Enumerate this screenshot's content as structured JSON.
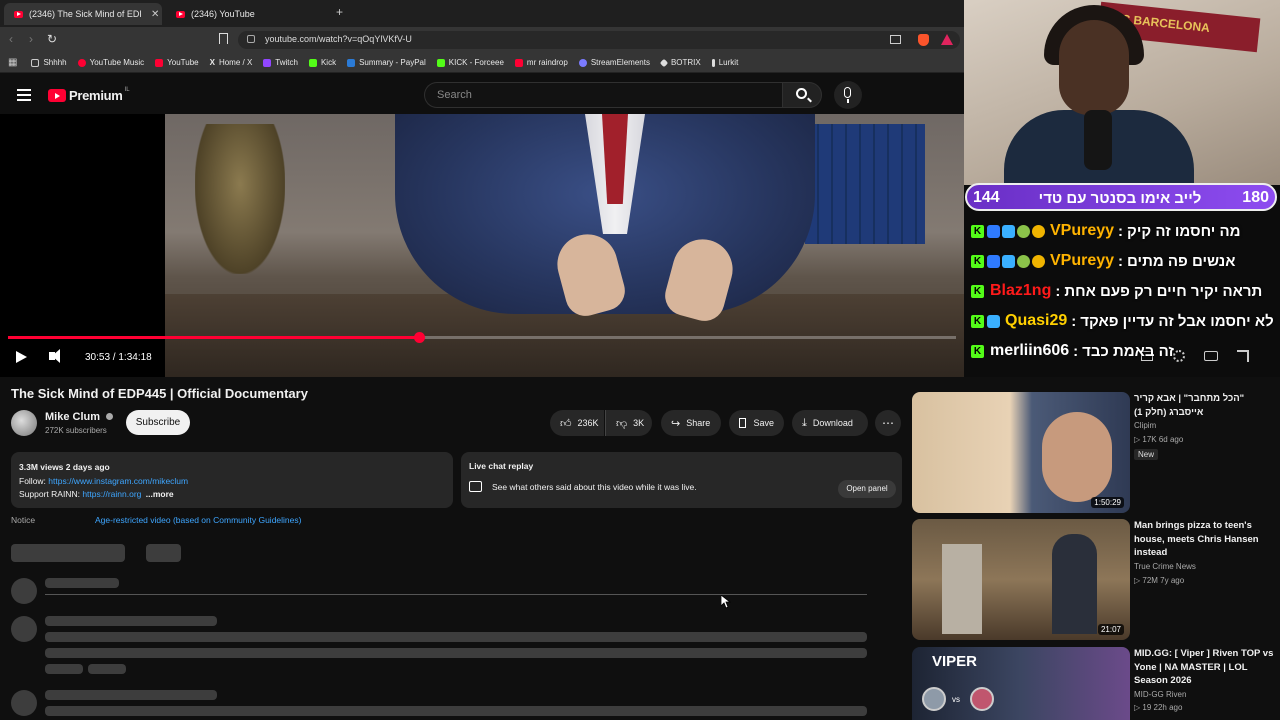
{
  "browser": {
    "tabs": [
      {
        "label": "(2346) The Sick Mind of EDP445",
        "active": true
      },
      {
        "label": "(2346) YouTube",
        "active": false
      }
    ],
    "new_tab": "+",
    "url": "youtube.com/watch?v=qOqYlVKfV-U",
    "bookmarks": [
      {
        "label": "Shhhh",
        "color": "#888888"
      },
      {
        "label": "YouTube Music",
        "color": "#ff0033"
      },
      {
        "label": "YouTube",
        "color": "#ff0033"
      },
      {
        "label": "Home / X",
        "color": "#ffffff"
      },
      {
        "label": "Twitch",
        "color": "#9146ff"
      },
      {
        "label": "Kick",
        "color": "#53fc18"
      },
      {
        "label": "Summary - PayPal",
        "color": "#2b7bd6"
      },
      {
        "label": "KICK - Forceee",
        "color": "#53fc18"
      },
      {
        "label": "mr raindrop",
        "color": "#ff0033"
      },
      {
        "label": "StreamElements",
        "color": "#7b7bff"
      },
      {
        "label": "BOTRIX",
        "color": "#dddddd"
      },
      {
        "label": "Lurkit",
        "color": "#dddddd"
      }
    ]
  },
  "youtube": {
    "logo": "Premium",
    "region": "IL",
    "search_placeholder": "Search"
  },
  "player": {
    "time": "30:53 / 1:34:18",
    "progress": 0.434
  },
  "overlay": {
    "banner": "FC BARCELONA",
    "left_count": "144",
    "right_count": "180",
    "header_title": "לייב אימו בסנטר עם טדי",
    "messages": [
      {
        "user": "VPureyy",
        "text": "מה יחסמו זה קיק",
        "color": "#ffb300"
      },
      {
        "user": "VPureyy",
        "text": "אנשים פה מתים",
        "color": "#ffb300"
      },
      {
        "user": "Blaz1ng",
        "text": "תראה יקיר חיים רק פעם אחת",
        "color": "#ff1a1a"
      },
      {
        "user": "Quasi29",
        "text": "לא יחסמו אבל זה עדיין פאקד",
        "color": "#ffd000"
      },
      {
        "user": "merliin606",
        "text": "זה באמת כבד",
        "color": "#ffffff"
      }
    ]
  },
  "video": {
    "title": "The Sick Mind of EDP445 | Official Documentary",
    "channel": "Mike Clum",
    "subscribers": "272K subscribers",
    "subscribe_label": "Subscribe",
    "likes": "236K",
    "dislikes": "3K",
    "share_label": "Share",
    "save_label": "Save",
    "download_label": "Download",
    "views_date": "3.3M views  2 days ago",
    "follow_label": "Follow: ",
    "follow_link": "https://www.instagram.com/mikeclum",
    "support_label": "Support RAINN: ",
    "support_link": "https://rainn.org",
    "more_label": "...more",
    "notice_label": "Notice",
    "notice_text": "Age-restricted video (based on Community Guidelines)"
  },
  "live_chat_replay": {
    "title": "Live chat replay",
    "text": "See what others said about this video while it was live.",
    "button": "Open panel"
  },
  "recommendations": [
    {
      "title": "\"הכל מתחבר\" | אבא קריר אייסברג (חלק 1)",
      "channel": "Clipim",
      "meta": "17K  6d ago",
      "badge": "New",
      "duration": "1:50:29"
    },
    {
      "title": "Man brings pizza to teen's house, meets Chris Hansen instead",
      "channel": "True Crime News",
      "meta": "72M  7y ago",
      "duration": "21:07"
    },
    {
      "title": "MID.GG: [ Viper ] Riven TOP vs Yone | NA MASTER | LOL Season 2026",
      "channel": "MID-GG Riven",
      "meta": "19  22h ago",
      "thumb_text": "VIPER",
      "vs": "vs"
    }
  ]
}
